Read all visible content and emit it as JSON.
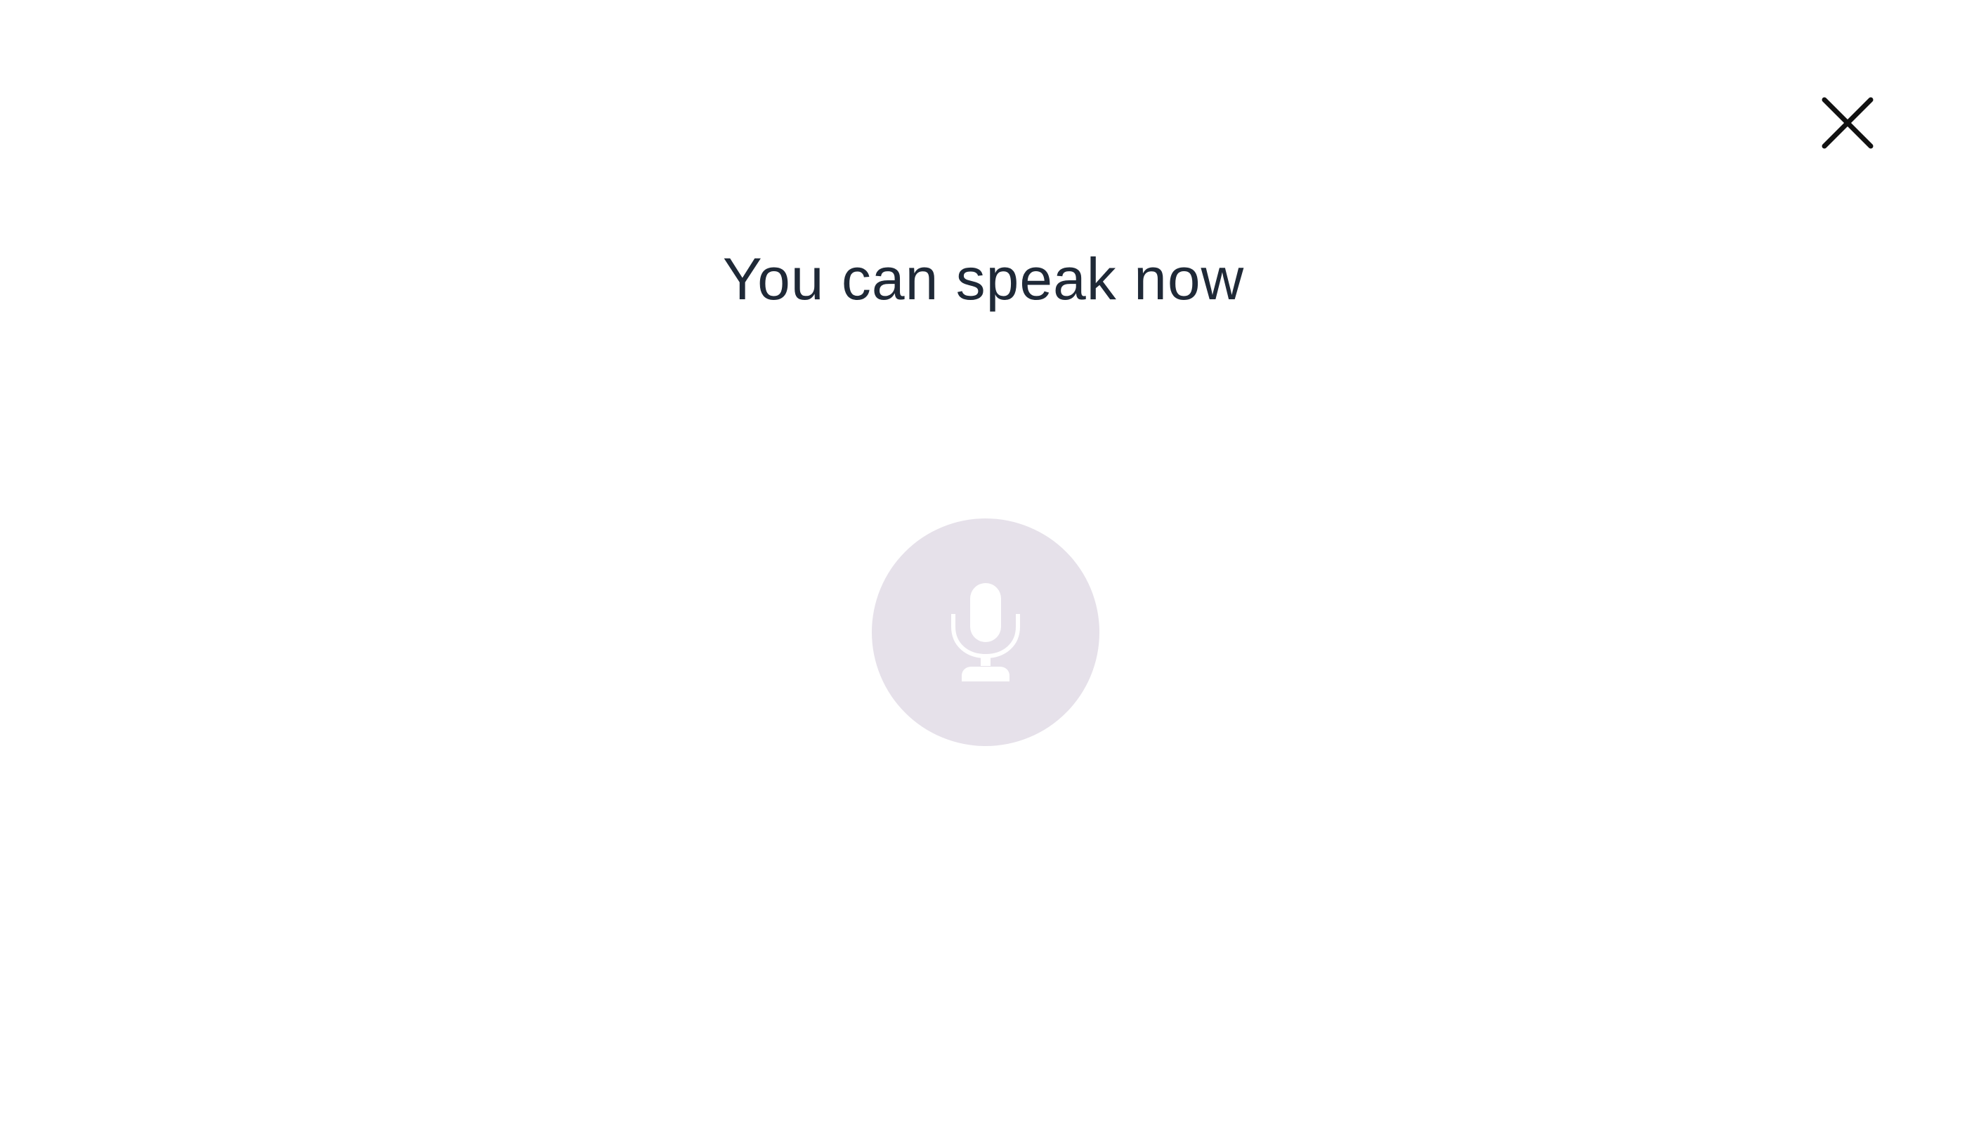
{
  "dialog": {
    "title": "You can speak now",
    "close_icon": "close-icon",
    "mic_icon": "microphone-icon"
  },
  "colors": {
    "background": "#ffffff",
    "title_text": "#1f2937",
    "mic_circle": "#e6e1ea",
    "mic_glyph": "#ffffff",
    "close_glyph": "#111111"
  }
}
